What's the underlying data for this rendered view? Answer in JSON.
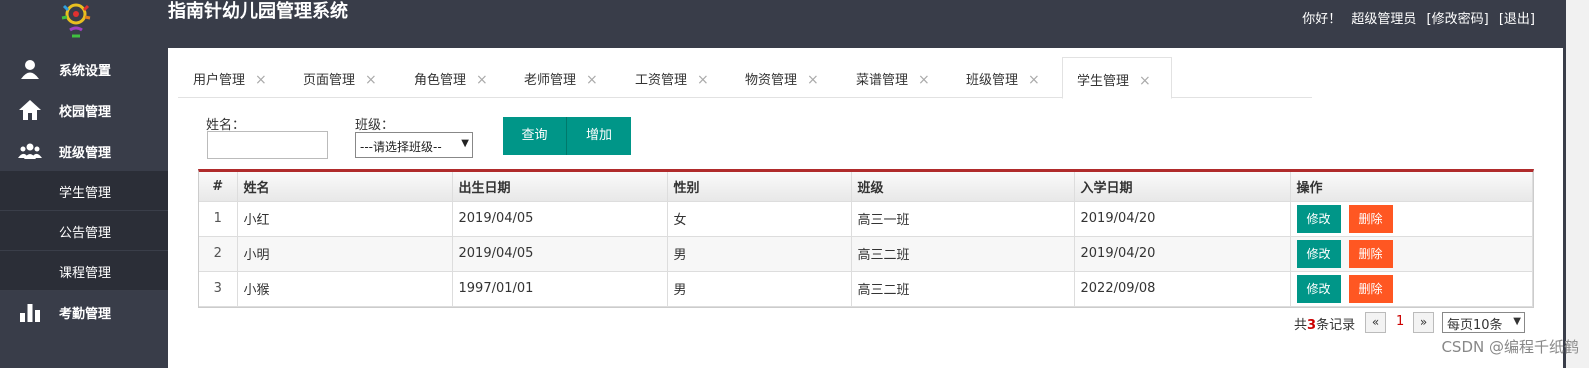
{
  "app": {
    "title": "指南针幼儿园管理系统"
  },
  "topbar": {
    "greeting": "你好！",
    "user": "超级管理员",
    "change_password": "[修改密码]",
    "logout": "[退出]"
  },
  "sidebar": {
    "groups": [
      {
        "label": "系统设置",
        "icon": "user-icon"
      },
      {
        "label": "校园管理",
        "icon": "home-icon"
      },
      {
        "label": "班级管理",
        "icon": "group-icon"
      }
    ],
    "sub_items": [
      {
        "label": "学生管理"
      },
      {
        "label": "公告管理"
      },
      {
        "label": "课程管理"
      }
    ],
    "last_group": {
      "label": "考勤管理",
      "icon": "bar-chart-icon"
    }
  },
  "tabs": [
    {
      "label": "用户管理"
    },
    {
      "label": "页面管理"
    },
    {
      "label": "角色管理"
    },
    {
      "label": "老师管理"
    },
    {
      "label": "工资管理"
    },
    {
      "label": "物资管理"
    },
    {
      "label": "菜谱管理"
    },
    {
      "label": "班级管理"
    },
    {
      "label": "学生管理",
      "active": true
    }
  ],
  "tab_close_glyph": "×",
  "search": {
    "name_label": "姓名：",
    "name_value": "",
    "class_label": "班级：",
    "class_selected": "---请选择班级--",
    "query_button": "查询",
    "add_button": "增加"
  },
  "table": {
    "headers": [
      "#",
      "姓名",
      "出生日期",
      "性别",
      "班级",
      "入学日期",
      "操作"
    ],
    "rows": [
      {
        "no": "1",
        "name": "小红",
        "birth": "2019/04/05",
        "gender": "女",
        "class": "高三一班",
        "enroll": "2019/04/20"
      },
      {
        "no": "2",
        "name": "小明",
        "birth": "2019/04/05",
        "gender": "男",
        "class": "高三二班",
        "enroll": "2019/04/20"
      },
      {
        "no": "3",
        "name": "小猴",
        "birth": "1997/01/01",
        "gender": "男",
        "class": "高三二班",
        "enroll": "2022/09/08"
      }
    ],
    "edit_label": "修改",
    "delete_label": "删除"
  },
  "pager": {
    "prefix": "共",
    "count": "3",
    "suffix": "条记录",
    "prev": "«",
    "current": "1",
    "next": "»",
    "page_size": "每页10条"
  },
  "watermark": "CSDN @编程千纸鹤",
  "colors": {
    "header_bg": "#393d49",
    "primary": "#009688",
    "danger": "#ff5722",
    "table_accent": "#b02b2c"
  }
}
